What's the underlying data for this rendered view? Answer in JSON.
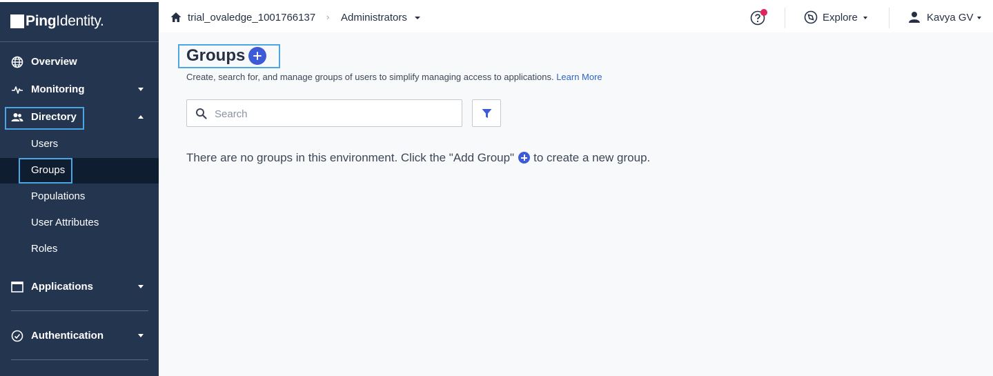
{
  "brand": {
    "logo_bold": "Ping",
    "logo_light": "Identity."
  },
  "header": {
    "environment": "trial_ovaledge_1001766137",
    "separator": "›",
    "section": "Administrators",
    "explore_label": "Explore",
    "user_name": "Kavya GV"
  },
  "sidebar": {
    "items": [
      {
        "label": "Overview",
        "icon": "globe-icon"
      },
      {
        "label": "Monitoring",
        "icon": "pulse-icon"
      },
      {
        "label": "Directory",
        "icon": "users-icon"
      },
      {
        "label": "Applications",
        "icon": "window-icon"
      },
      {
        "label": "Authentication",
        "icon": "check-circle-icon"
      }
    ],
    "directory_subitems": [
      "Users",
      "Groups",
      "Populations",
      "User Attributes",
      "Roles"
    ],
    "active_subitem": "Groups"
  },
  "main": {
    "title": "Groups",
    "description": "Create, search for, and manage groups of users to simplify managing access to applications.",
    "learn_more": "Learn More",
    "search_placeholder": "Search",
    "empty_before": "There are no groups in this environment. Click the \"Add Group\"",
    "empty_after": "to create a new group."
  },
  "colors": {
    "sidebar_bg": "#243550",
    "sidebar_active_bg": "#0f1d31",
    "accent": "#3d5bd6",
    "highlight": "#4aa6e4",
    "notification_dot": "#e0245e"
  }
}
